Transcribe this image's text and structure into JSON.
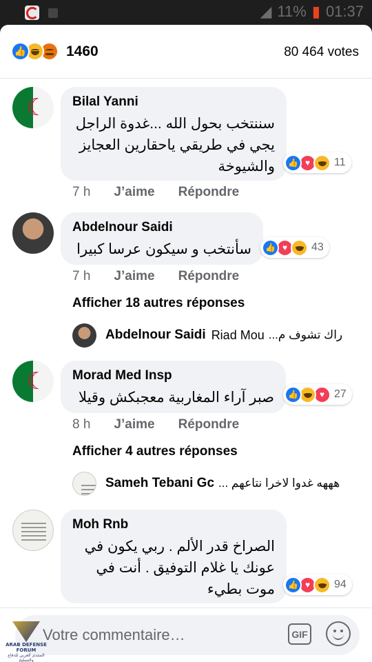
{
  "status_bar": {
    "battery": "11%",
    "time": "01:37"
  },
  "summary": {
    "reaction_count": "1460",
    "votes": "80 464 votes"
  },
  "comments": [
    {
      "author": "Bilal Yanni",
      "text": "سننتخب بحول الله ...غدوة الراجل يجي في طريقي ياحقارين العجايز والشيوخة",
      "reactions": [
        "like-icon",
        "love-icon",
        "haha-icon"
      ],
      "reaction_count": "11",
      "time": "7 h",
      "like": "J’aime",
      "reply": "Répondre"
    },
    {
      "author": "Abdelnour Saidi",
      "text": "سأنتخب و سيكون عرسا كبيرا",
      "reactions": [
        "like-icon",
        "love-icon",
        "haha-icon"
      ],
      "reaction_count": "43",
      "time": "7 h",
      "like": "J’aime",
      "reply": "Répondre",
      "more_replies": "Afficher 18 autres réponses",
      "reply_preview": {
        "author": "Abdelnour Saidi",
        "text": "Riad Mou",
        "arabic": "راك تشوف م..."
      }
    },
    {
      "author": "Morad Med Insp",
      "text": "صبر آراء المغاربية معجبكش وقيلا",
      "reactions": [
        "like-icon",
        "haha-icon",
        "love-icon"
      ],
      "reaction_count": "27",
      "time": "8 h",
      "like": "J’aime",
      "reply": "Répondre",
      "more_replies": "Afficher 4 autres réponses",
      "reply_preview": {
        "author": "Sameh Tebani Gc",
        "text": "",
        "arabic": "هههه غدوا لاخرا نتاعهم ..."
      }
    },
    {
      "author": "Moh Rnb",
      "text": "الصراخ قدر الألم . ربي يكون في عونك يا غلام التوفيق . أنت في موت بطيء",
      "reactions": [
        "like-icon",
        "love-icon",
        "haha-icon"
      ],
      "reaction_count": "94"
    }
  ],
  "composer": {
    "placeholder": "Votre commentaire…",
    "gif_label": "GIF"
  },
  "watermark": {
    "title": "ARAB DEFENSE FORUM",
    "subtitle": "المنتدى العربي للدفاع والتسليح"
  }
}
